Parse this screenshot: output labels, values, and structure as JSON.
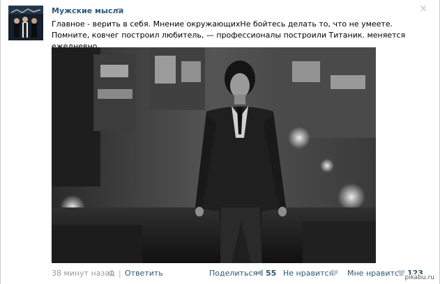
{
  "post": {
    "group_name": "Мужские мысли",
    "text": "Главное - верить в себя. Мнение окружающихНе бойтесь делать то, что не умеете. Помните, ковчег построил любитель, — профессионалы построили Титаник. меняется ежедневно.",
    "photo_description_icon": "man-walking-city-night-photo"
  },
  "footer": {
    "time": "38 минут назад",
    "separator": "|",
    "reply": "Ответить",
    "share_label": "Поделиться",
    "share_count": "55",
    "dislike_label": "Не нравится",
    "like_label": "Мне нравится",
    "like_count": "123"
  },
  "watermark": "pikabu.ru",
  "colors": {
    "link": "#2b587a",
    "meta": "#999999",
    "icon": "#a4acb6"
  }
}
